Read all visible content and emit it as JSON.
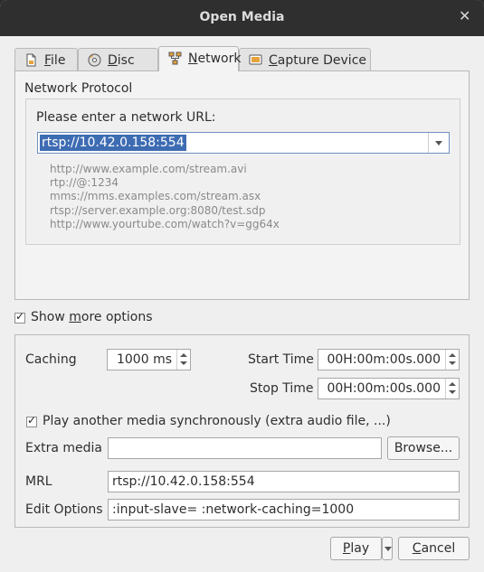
{
  "window": {
    "title": "Open Media"
  },
  "tabs": [
    {
      "label": "File",
      "icon": "file-icon"
    },
    {
      "label": "Disc",
      "icon": "disc-icon"
    },
    {
      "label": "Network",
      "icon": "network-icon"
    },
    {
      "label": "Capture Device",
      "icon": "capture-device-icon"
    }
  ],
  "network": {
    "protocol_label": "Network Protocol",
    "url_label": "Please enter a network URL:",
    "url_value": "rtsp://10.42.0.158:554",
    "examples": [
      "http://www.example.com/stream.avi",
      "rtp://@:1234",
      "mms://mms.examples.com/stream.asx",
      "rtsp://server.example.org:8080/test.sdp",
      "http://www.yourtube.com/watch?v=gg64x"
    ]
  },
  "show_more": {
    "label": "Show more options",
    "checked": true
  },
  "options": {
    "caching_label": "Caching",
    "caching_value": "1000 ms",
    "start_time_label": "Start Time",
    "start_time_value": "00H:00m:00s.000",
    "stop_time_label": "Stop Time",
    "stop_time_value": "00H:00m:00s.000",
    "sync_label": "Play another media synchronously (extra audio file, ...)",
    "sync_checked": true,
    "extra_media_label": "Extra media",
    "extra_media_value": "",
    "browse_label": "Browse...",
    "mrl_label": "MRL",
    "mrl_value": "rtsp://10.42.0.158:554",
    "edit_options_label": "Edit Options",
    "edit_options_value": ":input-slave= :network-caching=1000"
  },
  "footer": {
    "play_label": "Play",
    "cancel_label": "Cancel"
  },
  "colors": {
    "titlebar": "#2f2f2f",
    "selection": "#3e6cb3"
  }
}
